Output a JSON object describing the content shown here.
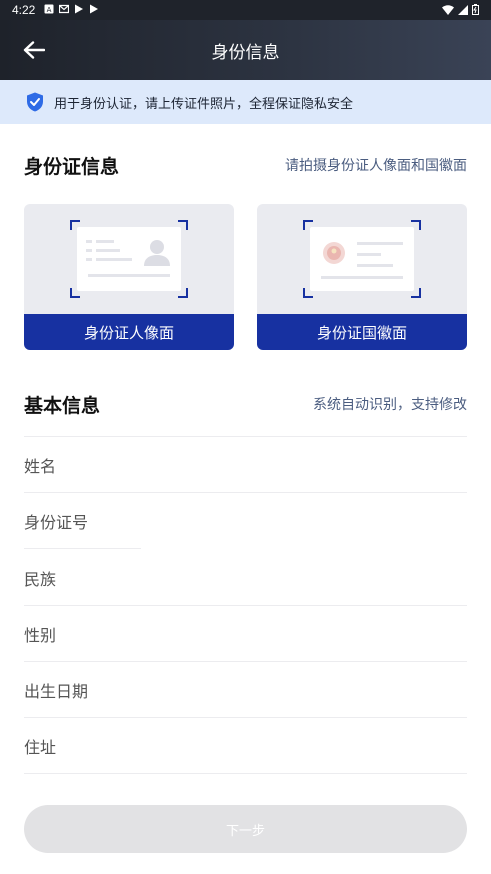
{
  "status_bar": {
    "time": "4:22",
    "icons_left": [
      "notification-a-icon",
      "gmail-icon",
      "play-icon",
      "play-icon"
    ],
    "icons_right": [
      "wifi-icon",
      "signal-icon",
      "battery-icon"
    ]
  },
  "header": {
    "title": "身份信息",
    "back_icon": "arrow-left-icon"
  },
  "notice": {
    "icon": "shield-check-icon",
    "text": "用于身份认证，请上传证件照片，全程保证隐私安全"
  },
  "id_section": {
    "title": "身份证信息",
    "hint": "请拍摄身份证人像面和国徽面",
    "cards": [
      {
        "label": "身份证人像面",
        "icon": "id-portrait-side-icon"
      },
      {
        "label": "身份证国徽面",
        "icon": "id-emblem-side-icon"
      }
    ]
  },
  "basic_section": {
    "title": "基本信息",
    "hint": "系统自动识别，支持修改",
    "fields": [
      {
        "label": "姓名"
      },
      {
        "label": "身份证号"
      },
      {
        "label": "民族"
      },
      {
        "label": "性别"
      },
      {
        "label": "出生日期"
      },
      {
        "label": "住址"
      }
    ]
  },
  "footer": {
    "next_label": "下一步"
  },
  "colors": {
    "accent": "#1731a1",
    "notice_bg": "#dde9fb",
    "header_dark": "#1e222a",
    "disabled_button": "#e2e2e4",
    "hint_text": "#4b5d80"
  }
}
